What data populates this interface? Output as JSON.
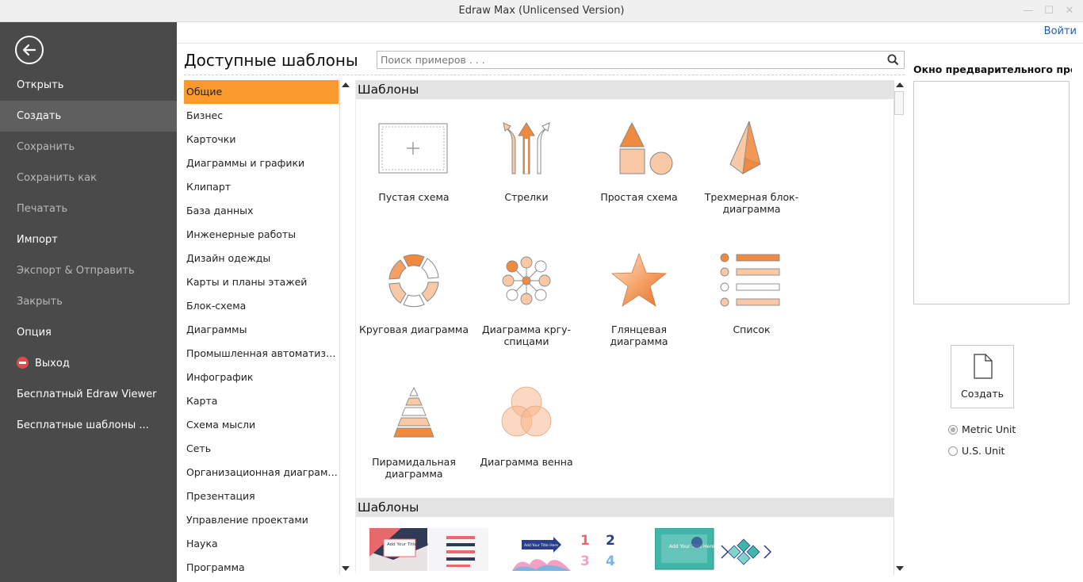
{
  "window": {
    "title": "Edraw Max (Unlicensed Version)"
  },
  "sidebar": {
    "items": [
      {
        "label": "Открыть",
        "state": "normal"
      },
      {
        "label": "Создать",
        "state": "active"
      },
      {
        "label": "Сохранить",
        "state": "disabled"
      },
      {
        "label": "Сохранить как",
        "state": "disabled"
      },
      {
        "label": "Печатать",
        "state": "disabled"
      },
      {
        "label": "Импорт",
        "state": "normal"
      },
      {
        "label": "Экспорт & Отправить",
        "state": "disabled"
      },
      {
        "label": "Закрыть",
        "state": "disabled"
      },
      {
        "label": "Опция",
        "state": "normal"
      },
      {
        "label": "Выход",
        "state": "normal"
      },
      {
        "label": "Бесплатный Edraw Viewer",
        "state": "normal"
      },
      {
        "label": "Бесплатные шаблоны ...",
        "state": "normal"
      }
    ]
  },
  "header": {
    "login": "Войти",
    "page_title": "Доступные шаблоны",
    "search_placeholder": "Поиск примеров . . ."
  },
  "categories": [
    "Общие",
    "Бизнес",
    "Карточки",
    "Диаграммы и графики",
    "Клипарт",
    "База данных",
    "Инженерные работы",
    "Дизайн одежды",
    "Карты и планы этажей",
    "Блок-схема",
    "Диаграммы",
    "Промышленная автоматизация",
    "Инфографик",
    "Карта",
    "Схема мысли",
    "Сеть",
    "Организационная диаграмма",
    "Презентация",
    "Управление проектами",
    "Наука",
    "Программа"
  ],
  "selected_category": "Общие",
  "gallery": {
    "section1_title": "Шаблоны",
    "section2_title": "Шаблоны",
    "tiles": [
      {
        "label": "Пустая схема",
        "icon": "blank-diagram-icon"
      },
      {
        "label": "Стрелки",
        "icon": "arrows-icon"
      },
      {
        "label": "Простая схема",
        "icon": "basic-shapes-icon"
      },
      {
        "label": "Трехмерная блок-диаграмма",
        "icon": "3d-block-icon"
      },
      {
        "label": "Круговая диаграмма",
        "icon": "circular-diagram-icon"
      },
      {
        "label": "Диаграмма кргу-спицами",
        "icon": "hub-spoke-icon"
      },
      {
        "label": "Глянцевая диаграмма",
        "icon": "glossy-star-icon"
      },
      {
        "label": "Список",
        "icon": "list-icon"
      },
      {
        "label": "Пирамидальная диаграмма",
        "icon": "pyramid-icon"
      },
      {
        "label": "Диаграмма венна",
        "icon": "venn-icon"
      }
    ],
    "thumbnail_texts": [
      "Add Your Title Here",
      "Add Your Title Here",
      "Add Your Title Here"
    ],
    "thumbnail_numbers": [
      "1",
      "2",
      "3",
      "4"
    ]
  },
  "preview": {
    "title": "Окно предварительного просмотра",
    "create_label": "Создать",
    "units": [
      {
        "label": "Metric Unit",
        "selected": true
      },
      {
        "label": "U.S. Unit",
        "selected": false
      }
    ]
  },
  "colors": {
    "accent": "#fa9a2d",
    "orange": "#f08a3e",
    "peach": "#f9c9a6",
    "sidebar": "#4a4a4a"
  }
}
